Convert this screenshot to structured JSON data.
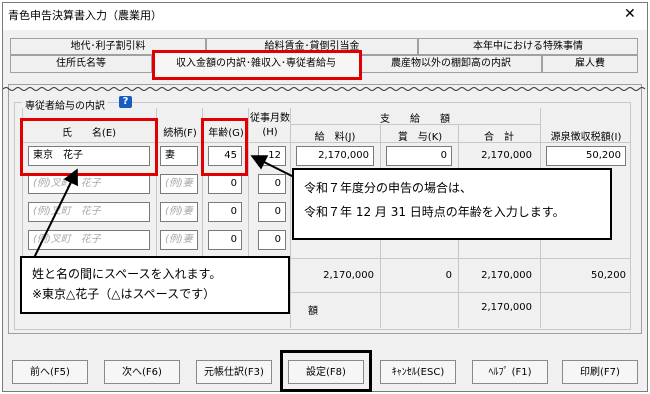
{
  "window": {
    "title": "青色申告決算書入力（農業用）"
  },
  "tabs": {
    "row1": [
      "地代･利子割引料",
      "給料賃金･貸倒引当金",
      "本年中における特殊事情"
    ],
    "row2": [
      "住所氏名等",
      "収入金額の内訳･雑収入･専従者給与",
      "農産物以外の棚卸高の内訳",
      "雇人費"
    ]
  },
  "group": {
    "label": "専従者給与の内訳",
    "help": "?"
  },
  "headers": {
    "name": "氏　　名(E)",
    "relation": "続柄(F)",
    "age": "年齢(G)",
    "months": "従事月数(H)",
    "salary_group": "支　　給　　額",
    "salary": "給　料(J)",
    "bonus": "賞　与(K)",
    "total": "合　計",
    "withholding": "源泉徴収税額(I)"
  },
  "rows": [
    {
      "name": "東京　花子",
      "relation": "妻",
      "age": "45",
      "months": "12",
      "salary": "2,170,000",
      "bonus": "0",
      "total": "2,170,000",
      "withholding": "50,200"
    },
    {
      "name": "(例)叉町　花子",
      "relation": "(例)妻",
      "age": "0",
      "months": "0"
    },
    {
      "name": "(例)叉町　花子",
      "relation": "(例)妻",
      "age": "0",
      "months": "0"
    },
    {
      "name": "(例)叉町　花子",
      "relation": "(例)妻",
      "age": "0",
      "months": "0"
    }
  ],
  "totals": {
    "salary": "2,170,000",
    "bonus": "0",
    "total": "2,170,000",
    "withholding": "50,200"
  },
  "subtotal": {
    "total": "2,170,000"
  },
  "partial_label": "額",
  "callouts": {
    "age": [
      "令和７年度分の申告の場合は、",
      "令和７年 12 月 31 日時点の年齢を入力します。"
    ],
    "name": [
      "姓と名の間にスペースを入れます。",
      "※東京△花子（△はスペースです）"
    ]
  },
  "buttons": [
    "前へ(F5)",
    "次へ(F6)",
    "元帳仕訳(F3)",
    "設定(F8)",
    "ｷｬﾝｾﾙ(ESC)",
    "ﾍﾙﾌﾟ (F1)",
    "印刷(F7)"
  ]
}
